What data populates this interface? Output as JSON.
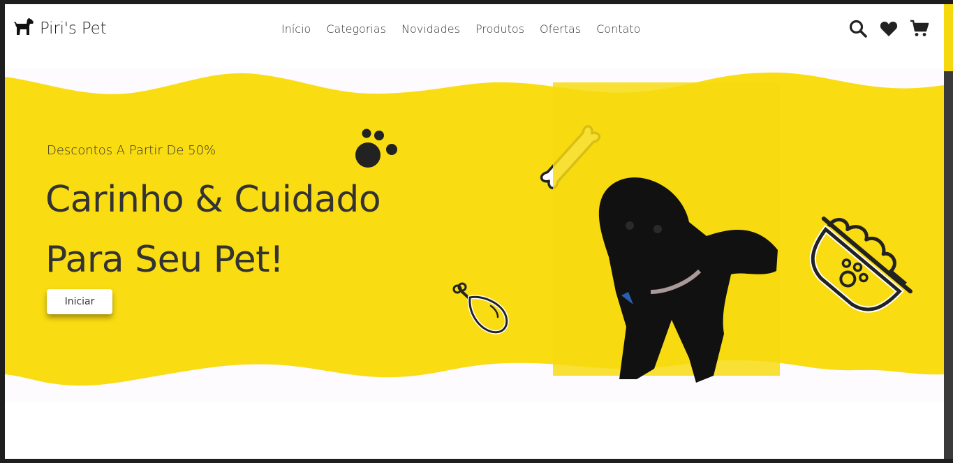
{
  "brand": {
    "name": "Piri's Pet",
    "logo_icon": "dog-icon"
  },
  "nav": {
    "items": [
      {
        "label": "Início"
      },
      {
        "label": "Categorias"
      },
      {
        "label": "Novidades"
      },
      {
        "label": "Produtos"
      },
      {
        "label": "Ofertas"
      },
      {
        "label": "Contato"
      }
    ]
  },
  "header_icons": [
    "search-icon",
    "heart-icon",
    "cart-icon"
  ],
  "hero": {
    "subtitle": "Descontos A Partir De 50%",
    "title_line1": "Carinho & Cuidado",
    "title_line2": "Para Seu Pet!",
    "cta_label": "Iniciar",
    "decorations": [
      "paw-icon",
      "bone-icon",
      "drumstick-icon",
      "pet-bowl-icon"
    ]
  },
  "colors": {
    "accent_yellow": "#f9dc12",
    "text_dark": "#333333",
    "background": "#ffffff"
  }
}
